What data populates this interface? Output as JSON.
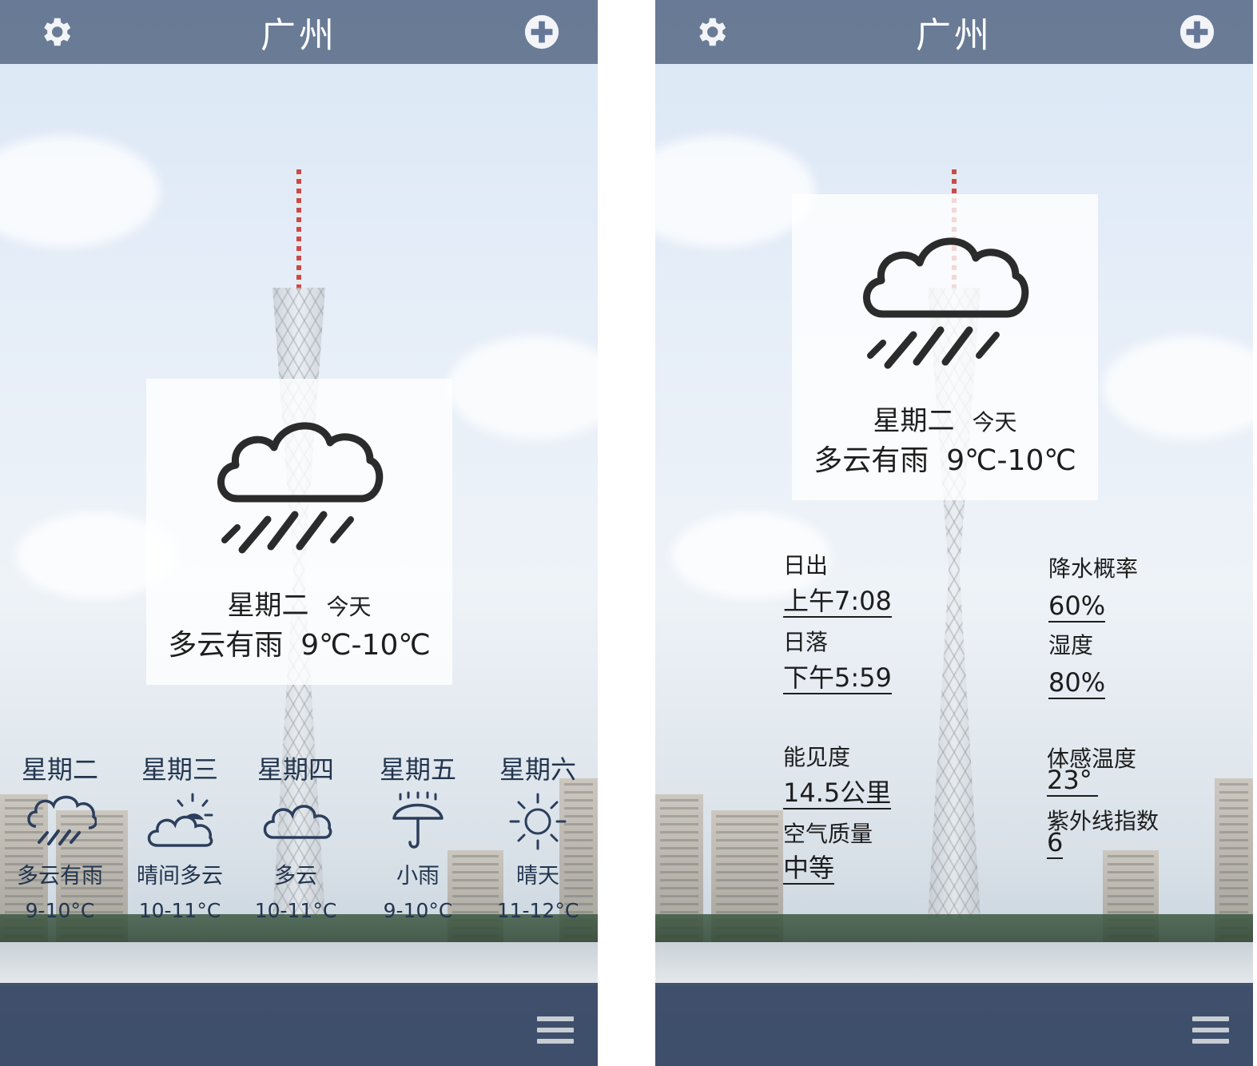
{
  "left": {
    "header": {
      "title": "广州",
      "settings_icon": "gear-icon",
      "add_icon": "plus-circle-icon"
    },
    "today": {
      "icon": "cloud-rain-icon",
      "weekday": "星期二",
      "label": "今天",
      "condition": "多云有雨",
      "temp": "9℃-10℃"
    },
    "forecast": [
      {
        "day": "星期二",
        "icon": "cloud-rain-icon",
        "condition": "多云有雨",
        "temp": "9-10°C"
      },
      {
        "day": "星期三",
        "icon": "partly-sunny-icon",
        "condition": "晴间多云",
        "temp": "10-11°C"
      },
      {
        "day": "星期四",
        "icon": "cloud-icon",
        "condition": "多云",
        "temp": "10-11°C"
      },
      {
        "day": "星期五",
        "icon": "umbrella-rain-icon",
        "condition": "小雨",
        "temp": "9-10°C"
      },
      {
        "day": "星期六",
        "icon": "sun-icon",
        "condition": "晴天",
        "temp": "11-12°C"
      }
    ],
    "footer": {
      "menu_icon": "menu-icon"
    }
  },
  "right": {
    "header": {
      "title": "广州",
      "settings_icon": "gear-icon",
      "add_icon": "plus-circle-icon"
    },
    "today": {
      "icon": "cloud-rain-icon",
      "weekday": "星期二",
      "label": "今天",
      "condition": "多云有雨",
      "temp": "9℃-10℃"
    },
    "details": {
      "sunrise_label": "日出",
      "sunrise_value": "上午7:08",
      "sunset_label": "日落",
      "sunset_value": "下午5:59",
      "precip_label": "降水概率",
      "precip_value": "60%",
      "humidity_label": "湿度",
      "humidity_value": "80%",
      "visibility_label": "能见度",
      "visibility_value": "14.5公里",
      "air_label": "空气质量",
      "air_value": "中等",
      "feels_label": "体感温度",
      "feels_value": "23°",
      "uv_label": "紫外线指数",
      "uv_value": "6"
    },
    "footer": {
      "menu_icon": "menu-icon"
    }
  }
}
